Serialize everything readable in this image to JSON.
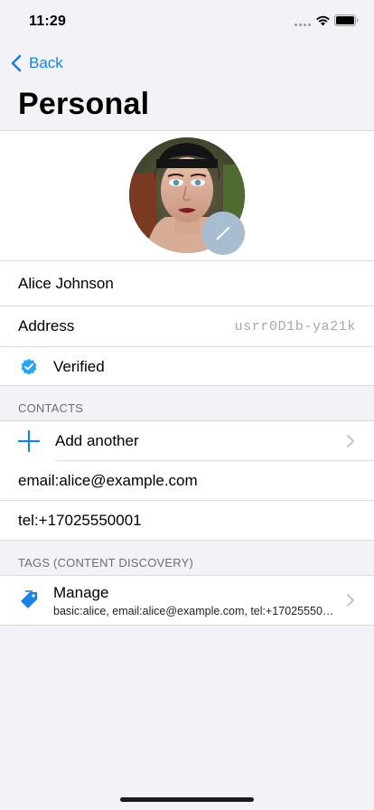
{
  "status": {
    "time": "11:29"
  },
  "nav": {
    "back_label": "Back",
    "title": "Personal"
  },
  "profile": {
    "name": "Alice Johnson",
    "address_label": "Address",
    "address_value": "usrr0D1b-ya21k",
    "verified_label": "Verified"
  },
  "contacts": {
    "header": "CONTACTS",
    "add_label": "Add another",
    "items": [
      "email:alice@example.com",
      "tel:+17025550001"
    ]
  },
  "tags": {
    "header": "TAGS (CONTENT DISCOVERY)",
    "manage_label": "Manage",
    "manage_subtitle": "basic:alice, email:alice@example.com, tel:+17025550…"
  },
  "colors": {
    "accent": "#1a82e2",
    "verified": "#2aa3f0",
    "background": "#f2f2f7"
  }
}
